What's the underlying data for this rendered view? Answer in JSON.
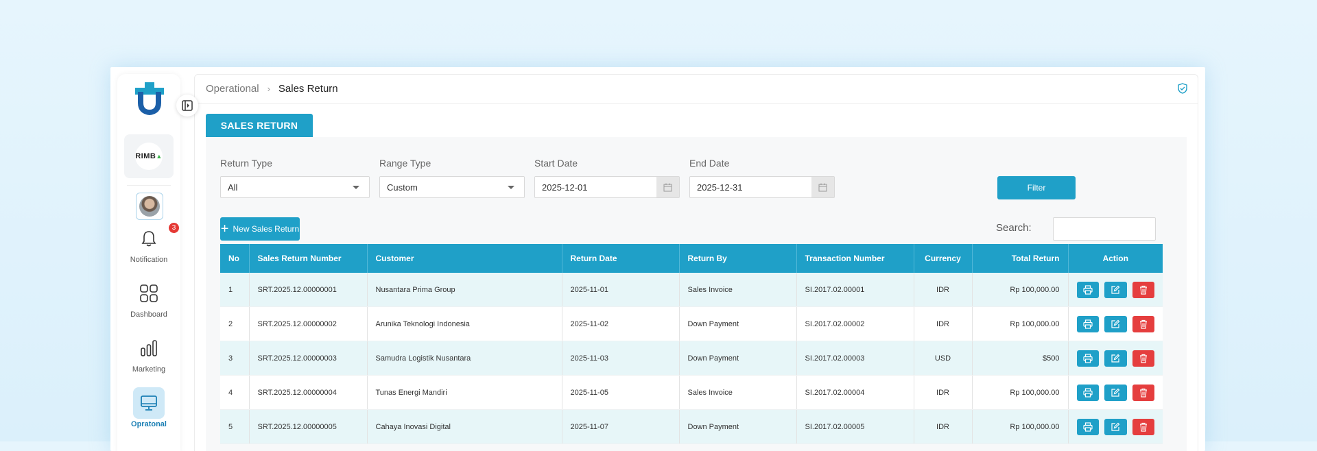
{
  "breadcrumb": {
    "parent": "Operational",
    "separator": "›",
    "current": "Sales Return"
  },
  "sidebar": {
    "company_logo_text": "RIMB",
    "notification_count": "3",
    "items": [
      {
        "label": "Notification",
        "icon": "bell-icon"
      },
      {
        "label": "Dashboard",
        "icon": "grid-icon"
      },
      {
        "label": "Marketing",
        "icon": "bar-chart-icon"
      },
      {
        "label": "Opratonal",
        "icon": "monitor-icon"
      }
    ]
  },
  "tab": {
    "label": "SALES RETURN"
  },
  "filters": {
    "return_type": {
      "label": "Return Type",
      "value": "All"
    },
    "range_type": {
      "label": "Range Type",
      "value": "Custom"
    },
    "start_date": {
      "label": "Start Date",
      "value": "2025-12-01"
    },
    "end_date": {
      "label": "End Date",
      "value": "2025-12-31"
    },
    "filter_button": "Filter"
  },
  "toolbar": {
    "new_button": "New Sales Return",
    "search_label": "Search:"
  },
  "table": {
    "headers": [
      "No",
      "Sales Return Number",
      "Customer",
      "Return Date",
      "Return By",
      "Transaction Number",
      "Currency",
      "Total Return",
      "Action"
    ],
    "rows": [
      {
        "no": "1",
        "number": "SRT.2025.12.00000001",
        "customer": "Nusantara Prima Group",
        "date": "2025-11-01",
        "by": "Sales Invoice",
        "trx": "SI.2017.02.00001",
        "currency": "IDR",
        "total": "Rp 100,000.00"
      },
      {
        "no": "2",
        "number": "SRT.2025.12.00000002",
        "customer": "Arunika Teknologi Indonesia",
        "date": "2025-11-02",
        "by": "Down Payment",
        "trx": "SI.2017.02.00002",
        "currency": "IDR",
        "total": "Rp 100,000.00"
      },
      {
        "no": "3",
        "number": "SRT.2025.12.00000003",
        "customer": "Samudra Logistik Nusantara",
        "date": "2025-11-03",
        "by": "Down Payment",
        "trx": "SI.2017.02.00003",
        "currency": "USD",
        "total": "$500"
      },
      {
        "no": "4",
        "number": "SRT.2025.12.00000004",
        "customer": "Tunas Energi Mandiri",
        "date": "2025-11-05",
        "by": "Sales Invoice",
        "trx": "SI.2017.02.00004",
        "currency": "IDR",
        "total": "Rp 100,000.00"
      },
      {
        "no": "5",
        "number": "SRT.2025.12.00000005",
        "customer": "Cahaya Inovasi Digital",
        "date": "2025-11-07",
        "by": "Down Payment",
        "trx": "SI.2017.02.00005",
        "currency": "IDR",
        "total": "Rp 100,000.00"
      }
    ]
  },
  "colors": {
    "primary": "#1fa0c8",
    "danger": "#e53e3e",
    "row_alt": "#e7f6f8"
  }
}
